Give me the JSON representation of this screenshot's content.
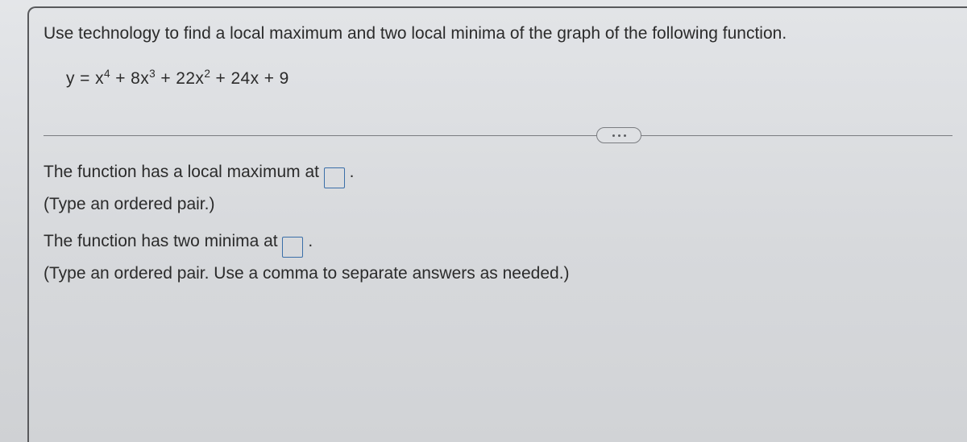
{
  "question": {
    "prompt": "Use technology to find a local maximum and two local minima of the graph of the following function.",
    "equation_parts": {
      "lhs": "y",
      "eq": "=",
      "x": "x",
      "p4": "4",
      "plus1": " + 8x",
      "p3": "3",
      "plus2": " + 22x",
      "p2": "2",
      "tail": " + 24x + 9"
    }
  },
  "answers": {
    "max_line_prefix": "The function has a local maximum at ",
    "max_line_suffix": ".",
    "max_hint": "(Type an ordered pair.)",
    "min_line_prefix": "The function has two minima at ",
    "min_line_suffix": ".",
    "min_hint": "(Type an ordered pair. Use a comma to separate answers as needed.)",
    "max_value": "",
    "min_value": ""
  },
  "more_button_aria": "More options"
}
